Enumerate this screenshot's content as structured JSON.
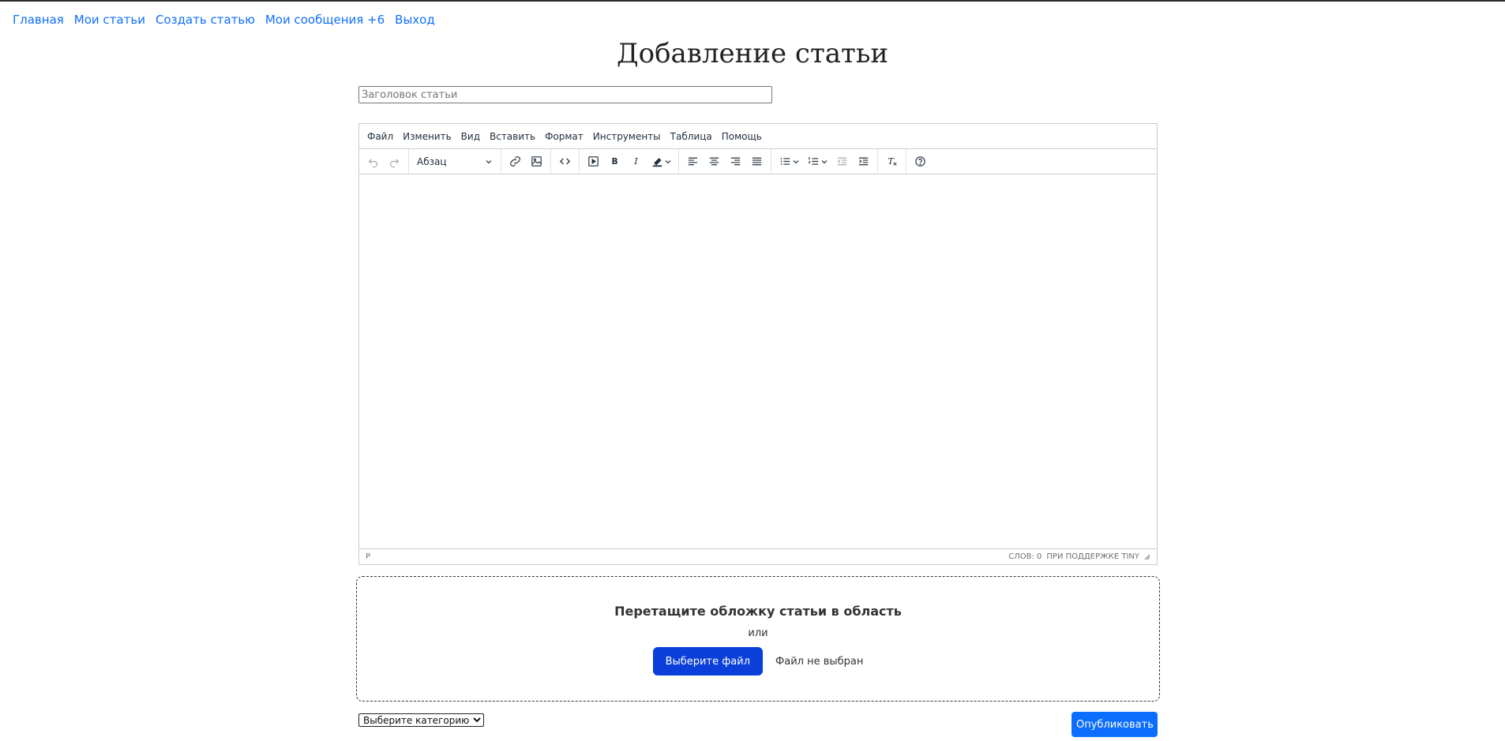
{
  "nav": {
    "items": [
      "Главная",
      "Мои статьи",
      "Создать статью",
      "Мои сообщения +6",
      "Выход"
    ]
  },
  "page": {
    "title": "Добавление статьи"
  },
  "form": {
    "title_placeholder": "Заголовок статьи",
    "title_value": ""
  },
  "editor": {
    "menu": [
      "Файл",
      "Изменить",
      "Вид",
      "Вставить",
      "Формат",
      "Инструменты",
      "Таблица",
      "Помощь"
    ],
    "block_format": "Абзац",
    "status_path": "P",
    "word_count": "СЛОВ: 0",
    "branding": "ПРИ ПОДДЕРЖКЕ TINY"
  },
  "dropzone": {
    "title": "Перетащите обложку статьи в область",
    "or": "или",
    "button": "Выберите файл",
    "status": "Файл не выбран"
  },
  "category": {
    "selected": "Выберите категорию"
  },
  "publish": {
    "label": "Опубликовать"
  },
  "colors": {
    "link": "#0d6efd",
    "file_button": "#0a40d9",
    "publish_button": "#0d6efd"
  }
}
